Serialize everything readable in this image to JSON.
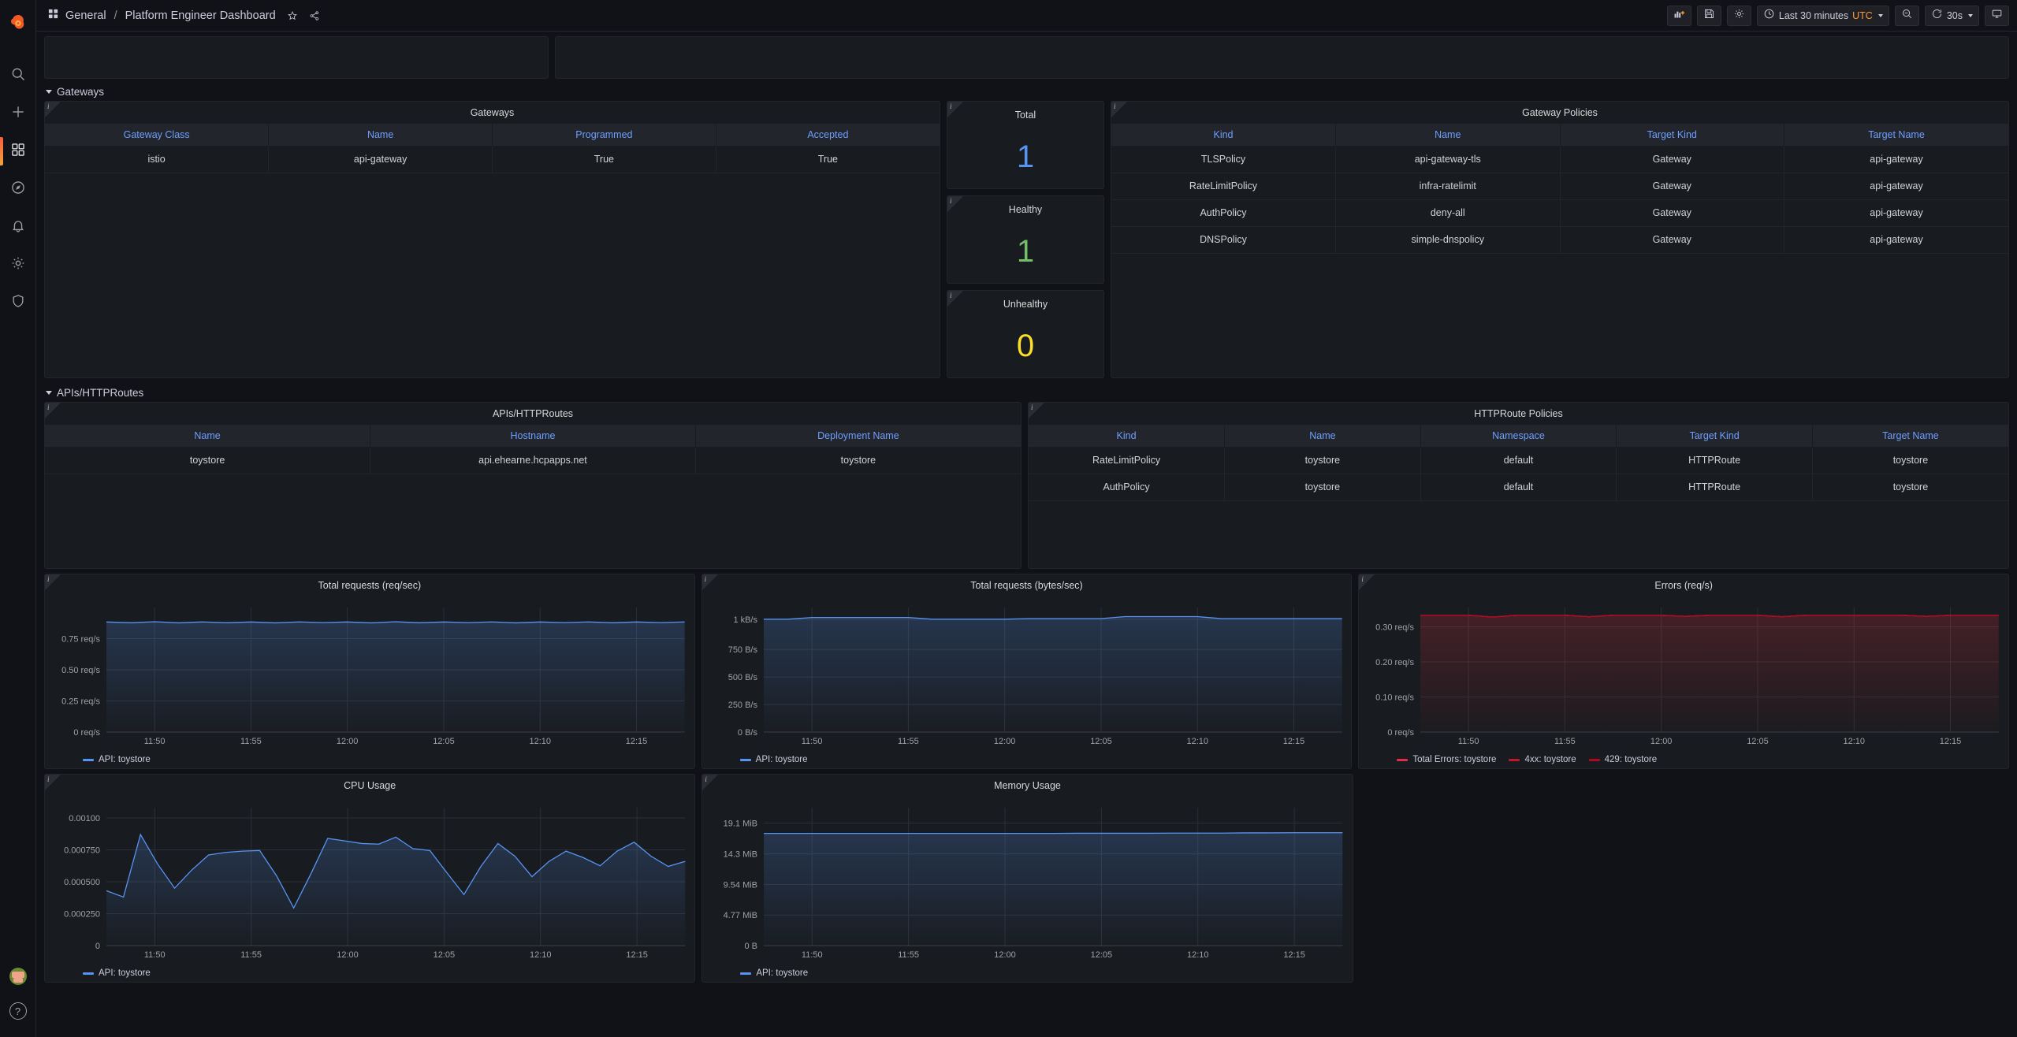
{
  "app": {
    "logo_name": "grafana-logo",
    "breadcrumb_folder": "General",
    "breadcrumb_separator": "/",
    "breadcrumb_title": "Platform Engineer Dashboard",
    "star_icon": "star-icon",
    "share_icon": "share-icon"
  },
  "sidebar": {
    "items": [
      {
        "name": "search",
        "icon": "search-icon"
      },
      {
        "name": "add",
        "icon": "plus-icon"
      },
      {
        "name": "dashboards",
        "icon": "dashboards-icon",
        "active": true
      },
      {
        "name": "explore",
        "icon": "compass-icon"
      },
      {
        "name": "alerting",
        "icon": "bell-icon"
      },
      {
        "name": "configuration",
        "icon": "gear-icon"
      },
      {
        "name": "server-admin",
        "icon": "shield-icon"
      }
    ],
    "bottom": [
      {
        "name": "user-avatar",
        "icon": "avatar-icon"
      },
      {
        "name": "help",
        "icon": "question-circle-icon"
      }
    ]
  },
  "toolbar": {
    "add_panel": {
      "label": "",
      "icon": "add-panel-icon"
    },
    "save": {
      "label": "",
      "icon": "save-icon"
    },
    "settings": {
      "label": "",
      "icon": "gear-icon"
    },
    "time_picker": {
      "icon": "clock-icon",
      "label": "Last 30 minutes",
      "timezone": "UTC"
    },
    "zoom_out": {
      "label": "",
      "icon": "zoom-out-icon"
    },
    "refresh": {
      "icon": "refresh-icon",
      "interval": "30s"
    },
    "kiosk": {
      "label": "",
      "icon": "monitor-icon"
    }
  },
  "sections": {
    "gateways": {
      "title": "Gateways"
    },
    "apis": {
      "title": "APIs/HTTPRoutes"
    }
  },
  "panels": {
    "gateways_table": {
      "title": "Gateways",
      "columns": [
        "Gateway Class",
        "Name",
        "Programmed",
        "Accepted"
      ],
      "rows": [
        [
          "istio",
          "api-gateway",
          "True",
          "True"
        ]
      ]
    },
    "total": {
      "title": "Total",
      "value": "1",
      "color": "#5794f2"
    },
    "healthy": {
      "title": "Healthy",
      "value": "1",
      "color": "#73bf69"
    },
    "unhealthy": {
      "title": "Unhealthy",
      "value": "0",
      "color": "#fade2a"
    },
    "gateway_policies": {
      "title": "Gateway Policies",
      "columns": [
        "Kind",
        "Name",
        "Target Kind",
        "Target Name"
      ],
      "rows": [
        [
          "TLSPolicy",
          "api-gateway-tls",
          "Gateway",
          "api-gateway"
        ],
        [
          "RateLimitPolicy",
          "infra-ratelimit",
          "Gateway",
          "api-gateway"
        ],
        [
          "AuthPolicy",
          "deny-all",
          "Gateway",
          "api-gateway"
        ],
        [
          "DNSPolicy",
          "simple-dnspolicy",
          "Gateway",
          "api-gateway"
        ]
      ]
    },
    "apis_table": {
      "title": "APIs/HTTPRoutes",
      "columns": [
        "Name",
        "Hostname",
        "Deployment Name"
      ],
      "rows": [
        [
          "toystore",
          "api.ehearne.hcpapps.net",
          "toystore"
        ]
      ]
    },
    "httproute_policies": {
      "title": "HTTPRoute Policies",
      "columns": [
        "Kind",
        "Name",
        "Namespace",
        "Target Kind",
        "Target Name"
      ],
      "rows": [
        [
          "RateLimitPolicy",
          "toystore",
          "default",
          "HTTPRoute",
          "toystore"
        ],
        [
          "AuthPolicy",
          "toystore",
          "default",
          "HTTPRoute",
          "toystore"
        ]
      ]
    }
  },
  "chart_data": [
    {
      "id": "total_requests_rps",
      "type": "line",
      "title": "Total requests (req/sec)",
      "xlabel": "",
      "ylabel": "",
      "x": [
        "11:50",
        "11:55",
        "12:00",
        "12:05",
        "12:10",
        "12:15"
      ],
      "ytick_labels": [
        "0 req/s",
        "0.25 req/s",
        "0.50 req/s",
        "0.75 req/s"
      ],
      "ytick_values": [
        0,
        0.25,
        0.5,
        0.75
      ],
      "ylim": [
        0,
        1.0
      ],
      "grid": true,
      "legend_position": "bottom",
      "series": [
        {
          "name": "API: toystore",
          "color": "#5794f2",
          "values": [
            0.884,
            0.878,
            0.886,
            0.877,
            0.885,
            0.878,
            0.884,
            0.877,
            0.885,
            0.879,
            0.884,
            0.877,
            0.886,
            0.878,
            0.884,
            0.879,
            0.885,
            0.877,
            0.884,
            0.879,
            0.885,
            0.878,
            0.884,
            0.879,
            0.885
          ]
        }
      ]
    },
    {
      "id": "total_requests_bps",
      "type": "line",
      "title": "Total requests (bytes/sec)",
      "xlabel": "",
      "ylabel": "",
      "x": [
        "11:50",
        "11:55",
        "12:00",
        "12:05",
        "12:10",
        "12:15"
      ],
      "ytick_labels": [
        "0 B/s",
        "250 B/s",
        "500 B/s",
        "750 B/s",
        "1 kB/s"
      ],
      "ytick_values": [
        0,
        250,
        500,
        750,
        1024
      ],
      "ylim": [
        0,
        1130
      ],
      "grid": true,
      "legend_position": "bottom",
      "series": [
        {
          "name": "API: toystore",
          "color": "#5794f2",
          "values": [
            1024,
            1024,
            1040,
            1040,
            1040,
            1040,
            1040,
            1024,
            1024,
            1024,
            1024,
            1030,
            1030,
            1030,
            1030,
            1048,
            1048,
            1048,
            1048,
            1030,
            1030,
            1030,
            1030,
            1030,
            1030
          ]
        }
      ]
    },
    {
      "id": "errors_rps",
      "type": "line",
      "title": "Errors (req/s)",
      "xlabel": "",
      "ylabel": "",
      "x": [
        "11:50",
        "11:55",
        "12:00",
        "12:05",
        "12:10",
        "12:15"
      ],
      "ytick_labels": [
        "0 req/s",
        "0.10 req/s",
        "0.20 req/s",
        "0.30 req/s"
      ],
      "ytick_values": [
        0,
        0.1,
        0.2,
        0.3
      ],
      "ylim": [
        0,
        0.355
      ],
      "grid": true,
      "legend_position": "bottom",
      "series": [
        {
          "name": "Total Errors: toystore",
          "color": "#e02f44",
          "values": [
            0.333,
            0.333,
            0.333,
            0.328,
            0.333,
            0.333,
            0.333,
            0.329,
            0.333,
            0.333,
            0.333,
            0.33,
            0.333,
            0.333,
            0.333,
            0.329,
            0.333,
            0.333,
            0.333,
            0.333,
            0.333,
            0.33,
            0.333,
            0.333,
            0.333
          ]
        },
        {
          "name": "4xx: toystore",
          "color": "#c4162a",
          "values": [
            0.333,
            0.333,
            0.333,
            0.328,
            0.333,
            0.333,
            0.333,
            0.329,
            0.333,
            0.333,
            0.333,
            0.33,
            0.333,
            0.333,
            0.333,
            0.329,
            0.333,
            0.333,
            0.333,
            0.333,
            0.333,
            0.33,
            0.333,
            0.333,
            0.333
          ]
        },
        {
          "name": "429: toystore",
          "color": "#b00a20",
          "values": [
            0.333,
            0.333,
            0.333,
            0.328,
            0.333,
            0.333,
            0.333,
            0.329,
            0.333,
            0.333,
            0.333,
            0.33,
            0.333,
            0.333,
            0.333,
            0.329,
            0.333,
            0.333,
            0.333,
            0.333,
            0.333,
            0.33,
            0.333,
            0.333,
            0.333
          ]
        }
      ]
    },
    {
      "id": "cpu_usage",
      "type": "line",
      "title": "CPU Usage",
      "xlabel": "",
      "ylabel": "",
      "x": [
        "11:50",
        "11:55",
        "12:00",
        "12:05",
        "12:10",
        "12:15"
      ],
      "ytick_labels": [
        "0",
        "0.000250",
        "0.000500",
        "0.000750",
        "0.00100"
      ],
      "ytick_values": [
        0,
        0.00025,
        0.0005,
        0.00075,
        0.001
      ],
      "ylim": [
        0,
        0.00108
      ],
      "grid": true,
      "legend_position": "bottom",
      "series": [
        {
          "name": "API: toystore",
          "color": "#5794f2",
          "values": [
            0.00043,
            0.00038,
            0.00087,
            0.00064,
            0.00045,
            0.00059,
            0.00071,
            0.00073,
            0.00074,
            0.000745,
            0.000545,
            0.000295,
            0.00056,
            0.00084,
            0.00082,
            0.0008,
            0.000795,
            0.00085,
            0.00076,
            0.000745,
            0.00057,
            0.0004,
            0.00062,
            0.0008,
            0.0007,
            0.00054,
            0.00066,
            0.00074,
            0.00069,
            0.000625,
            0.00074,
            0.00081,
            0.0007,
            0.00062,
            0.00066
          ]
        }
      ]
    },
    {
      "id": "memory_usage",
      "type": "line",
      "title": "Memory Usage",
      "xlabel": "",
      "ylabel": "",
      "x": [
        "11:50",
        "11:55",
        "12:00",
        "12:05",
        "12:10",
        "12:15"
      ],
      "ytick_labels": [
        "0 B",
        "4.77 MiB",
        "9.54 MiB",
        "14.3 MiB",
        "19.1 MiB"
      ],
      "ytick_values": [
        0,
        4.77,
        9.54,
        14.3,
        19.1
      ],
      "ylim": [
        0,
        21.5
      ],
      "grid": true,
      "legend_position": "bottom",
      "series": [
        {
          "name": "API: toystore",
          "color": "#5794f2",
          "values": [
            17.5,
            17.5,
            17.5,
            17.5,
            17.5,
            17.5,
            17.5,
            17.5,
            17.5,
            17.5,
            17.5,
            17.5,
            17.5,
            17.52,
            17.52,
            17.52,
            17.52,
            17.55,
            17.55,
            17.55,
            17.58,
            17.58,
            17.6,
            17.6,
            17.6
          ]
        }
      ]
    }
  ]
}
